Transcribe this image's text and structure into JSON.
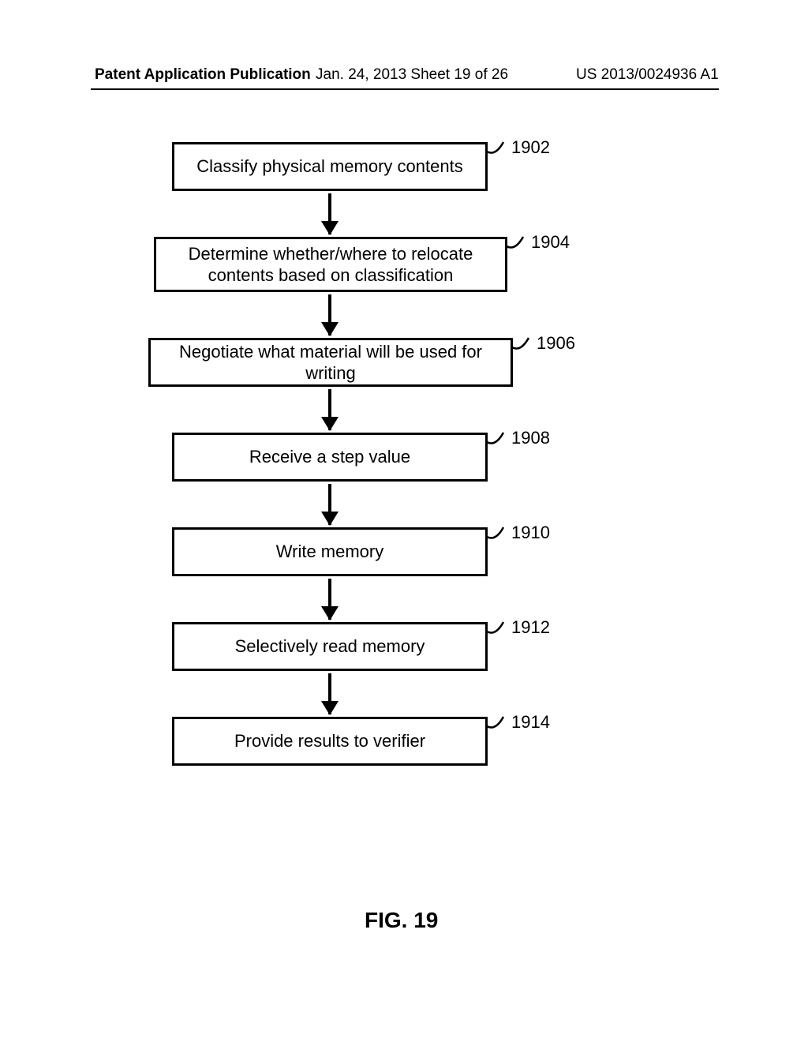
{
  "header": {
    "left": "Patent Application Publication",
    "mid": "Jan. 24, 2013  Sheet 19 of 26",
    "right": "US 2013/0024936 A1"
  },
  "flow": {
    "steps": [
      {
        "ref": "1902",
        "text": "Classify physical memory contents"
      },
      {
        "ref": "1904",
        "text": "Determine whether/where to relocate contents based on classification"
      },
      {
        "ref": "1906",
        "text": "Negotiate what material will be used for writing"
      },
      {
        "ref": "1908",
        "text": "Receive a step value"
      },
      {
        "ref": "1910",
        "text": "Write memory"
      },
      {
        "ref": "1912",
        "text": "Selectively read memory"
      },
      {
        "ref": "1914",
        "text": "Provide results to verifier"
      }
    ]
  },
  "figure_label": "FIG. 19"
}
